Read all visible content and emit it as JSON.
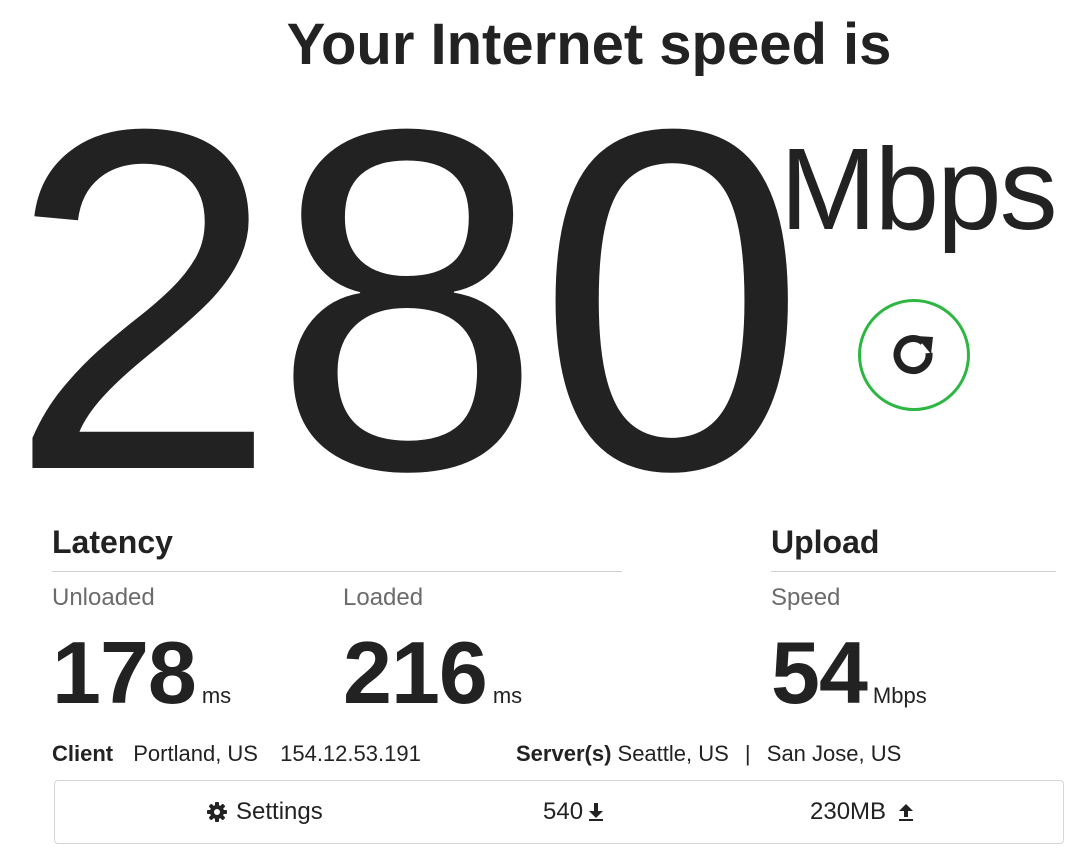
{
  "heading": "Your Internet speed is",
  "download": {
    "value": "280",
    "unit": "Mbps"
  },
  "refresh": {
    "icon": "refresh-icon",
    "color": "#2db742"
  },
  "latency": {
    "title": "Latency",
    "unloaded_label": "Unloaded",
    "unloaded_value": "178",
    "unloaded_unit": "ms",
    "loaded_label": "Loaded",
    "loaded_value": "216",
    "loaded_unit": "ms"
  },
  "upload": {
    "title": "Upload",
    "speed_label": "Speed",
    "speed_value": "54",
    "speed_unit": "Mbps"
  },
  "info": {
    "client_label": "Client",
    "client_location": "Portland, US",
    "client_ip": "154.12.53.191",
    "server_label": "Server(s)",
    "server_1": "Seattle, US",
    "separator": "|",
    "server_2": "San Jose, US"
  },
  "footer": {
    "settings_icon": "gear-icon",
    "settings_label": "Settings",
    "download_count": "540",
    "download_icon": "download-arrow-icon",
    "upload_amount": "230MB",
    "upload_icon": "upload-arrow-icon"
  }
}
